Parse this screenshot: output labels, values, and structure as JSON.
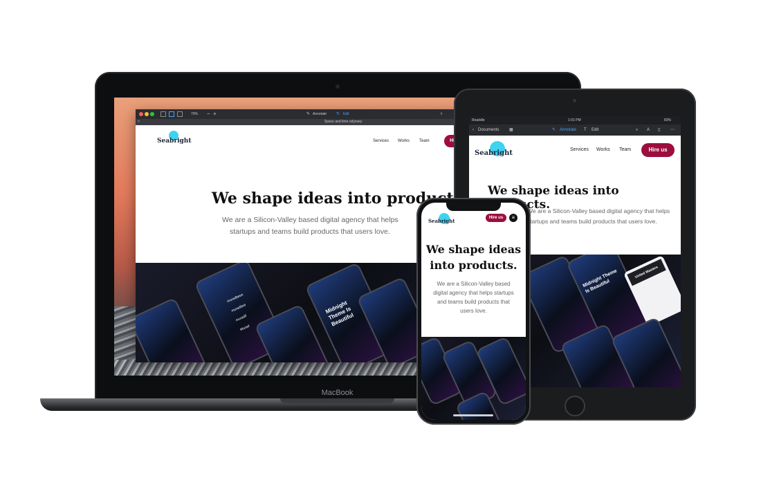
{
  "site": {
    "logo": "Seabright",
    "nav": [
      "Services",
      "Works",
      "Team"
    ],
    "cta": "Hire us",
    "headline": "We shape ideas into products.",
    "subtext": "We are a Silicon-Valley based digital agency that helps startups and teams build products that users love."
  },
  "laptop": {
    "brand": "MacBook",
    "app": {
      "window_title": "Space and time odyssey",
      "zoom": "70%",
      "annotate_label": "Annotate",
      "edit_label": "Edit"
    },
    "headline_line1": "We shape ideas into products.",
    "subtext_line1": "We are a Silicon-Valley based digital agency that helps",
    "subtext_line2": "startups and teams build products that users love.",
    "showcase": {
      "phone_title": "Midnight Theme Is Beautiful",
      "usernames": [
        "muradbeee",
        "muradbee",
        "muradif",
        "Murad"
      ]
    }
  },
  "ipad": {
    "status": {
      "app": "Readdle",
      "time": "1:01 PM",
      "battery": "83%"
    },
    "toolbar": {
      "back": "Documents",
      "annotate": "Annotate",
      "edit": "Edit"
    },
    "headline": "We shape ideas into products.",
    "subtext_line1": "We are a Silicon-Valley based digital agency that helps",
    "subtext_line2": "startups and teams build products that users love.",
    "showcase": {
      "phone_title": "Midnight Theme Is Beautiful",
      "card_title": "United Masters"
    }
  },
  "phone": {
    "headline_line1": "We shape ideas",
    "headline_line2": "into products.",
    "subtext_lines": [
      "We are a Silicon-Valley based",
      "digital agency that helps startups",
      "and teams build products that",
      "users love."
    ]
  },
  "colors": {
    "accent": "#9b0e3d",
    "logo_bubble": "#3ed3f0"
  }
}
